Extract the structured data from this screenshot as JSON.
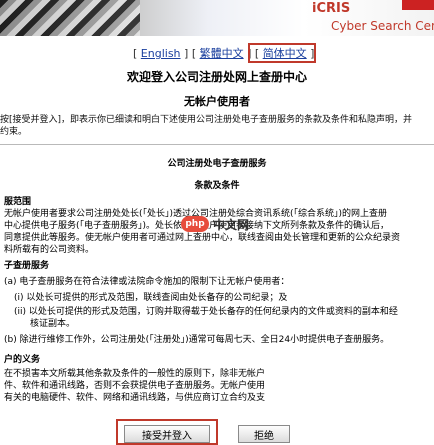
{
  "header": {
    "brand": "iCRIS",
    "tagline": "Cyber Search Centre"
  },
  "languages": {
    "items": [
      "English",
      "繁體中文",
      "简体中文"
    ],
    "selected": "简体中文"
  },
  "welcome_title": "欢迎登入公司注册处网上查册中心",
  "user_type": "无帐户使用者",
  "notice_lines": [
    "按[接受并登入]，即表示你已细读和明白下述使用公司注册处电子查册服务的条款及条件和私隐声明，并",
    "约束。"
  ],
  "terms": {
    "heading": "公司注册处电子查册服务",
    "subheading": "条款及条件",
    "section1_title": "服范围",
    "section1_lines": [
      "无帐户使用者要求公司注册处处长(「处长」)透过公司注册处综合资讯系统(「综合系统」)的网上查册",
      "中心提供电子服务(「电子查册服务」)。处长依照无帐户使用者接纳下文所列条款及条件的确认后，",
      "同意提供此等服务。使无帐户使用者可通过网上查册中心，联线查阅由处长管理和更新的公众纪录资",
      "料所载有的公司资料。"
    ],
    "section2_title": "子查册服务",
    "item_a": "(a)  电子查册服务在符合法律或法院命令施加的限制下让无帐户使用者：",
    "item_i": "(i)  以处长可提供的形式及范围，联线查阅由处长备存的公司纪录；及",
    "item_ii_lines": [
      "(ii)  以处长可提供的形式及范围，订购并取得载于处长备存的任何纪录内的文件或资料的副本和经",
      "核证副本。"
    ],
    "item_b": "(b)  除进行维修工作外，公司注册处(「注册处」)通常可每周七天、全日24小时提供电子查册服务。",
    "section3_title": "户的义务",
    "section3_lines": [
      "在不损害本文所载其他条款及条件的一般性的原则下，除非无帐户",
      "件、软件和通讯线路，否则不会获提供电子查册服务。无帐户使用",
      "有关的电脑硬件、软件、网络和通讯线路，与供应商订立合约及支"
    ]
  },
  "watermark": {
    "badge": "php",
    "text": "中文网"
  },
  "buttons": {
    "accept": "接受并登入",
    "reject": "拒绝"
  }
}
